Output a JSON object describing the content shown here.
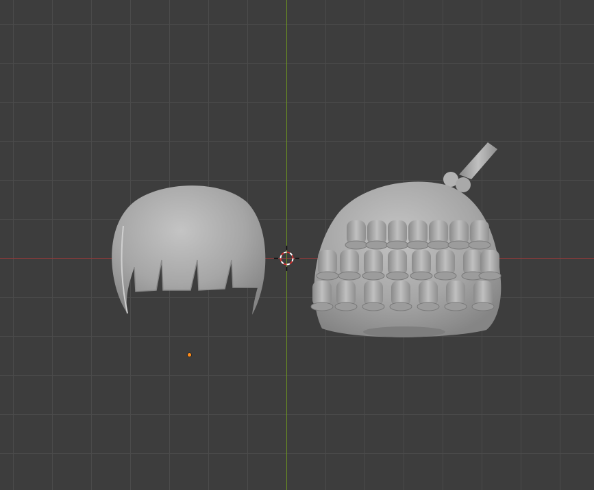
{
  "viewport": {
    "background_color": "#3d3d3d",
    "grid_color": "#4a4a4a",
    "x_axis_color": "#8b3a3a",
    "y_axis_color": "#6a8e23",
    "mesh_color": "#a8a8a8",
    "origin_color": "#ff8c1a"
  },
  "objects": [
    {
      "name_icon": "hair-bob-mesh"
    },
    {
      "name_icon": "hair-layered-mesh"
    }
  ]
}
